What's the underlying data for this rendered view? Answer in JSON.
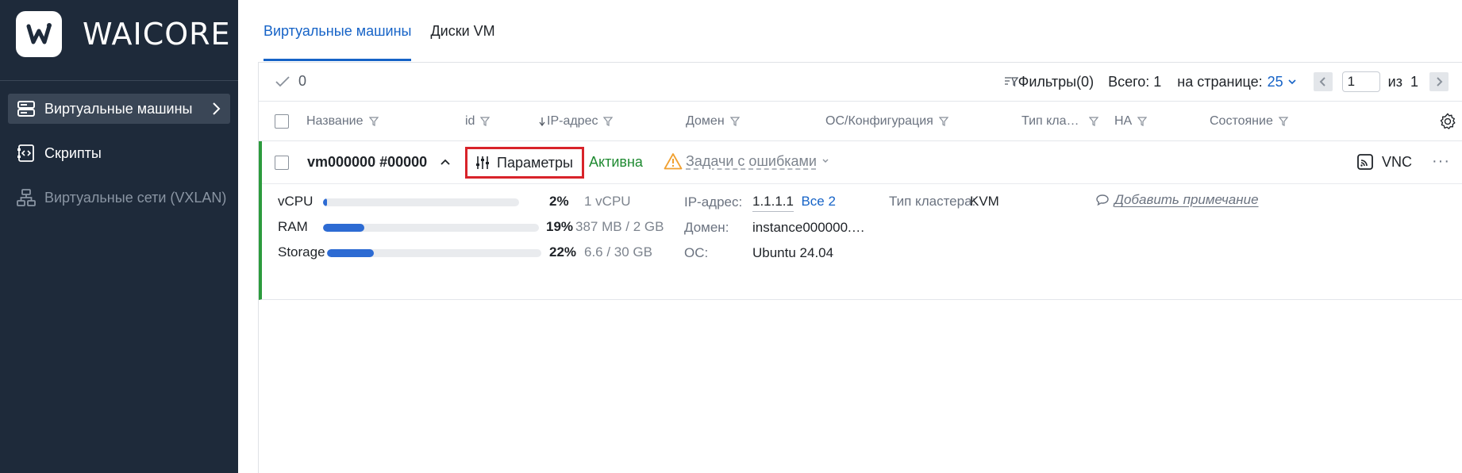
{
  "sidebar": {
    "brand": "WAICORE",
    "items": [
      {
        "label": "Виртуальные машины",
        "icon": "server-icon",
        "active": true
      },
      {
        "label": "Скрипты",
        "icon": "script-icon"
      },
      {
        "label": "Виртуальные сети (VXLAN)",
        "icon": "network-icon",
        "disabled": true
      }
    ]
  },
  "tabs": [
    {
      "label": "Виртуальные машины",
      "active": true
    },
    {
      "label": "Диски VM"
    }
  ],
  "toolbar": {
    "selected_count": "0",
    "filters_label": "Фильтры(0)",
    "total": "Всего: 1",
    "per_page_label": "на странице:",
    "per_page_value": "25",
    "page_value": "1",
    "of_label": "из",
    "total_pages": "1"
  },
  "columns": [
    "Название",
    "id",
    "IP-адрес",
    "Домен",
    "ОС/Конфигурация",
    "Тип кла…",
    "HA",
    "Состояние"
  ],
  "vm": {
    "name": "vm000000 #00000",
    "params_label": "Параметры",
    "status": "Активна",
    "tasks_label": "Задачи с ошибками",
    "vnc_label": "VNC",
    "more": "···",
    "metrics": [
      {
        "label": "vCPU",
        "percent": 2,
        "percent_text": "2%",
        "value": "1 vCPU"
      },
      {
        "label": "RAM",
        "percent": 19,
        "percent_text": "19%",
        "value": "387 MB / 2 GB"
      },
      {
        "label": "Storage",
        "percent": 22,
        "percent_text": "22%",
        "value": "6.6 / 30 GB"
      }
    ],
    "ip_label": "IP-адрес:",
    "ip_value": "1.1.1.1",
    "ip_all_link": "Все 2",
    "domain_label": "Домен:",
    "domain_value": "instance000000.…",
    "os_label": "ОС:",
    "os_value": "Ubuntu 24.04",
    "cluster_label": "Тип кластера:",
    "cluster_value": "KVM",
    "note_link": "Добавить примечание"
  },
  "colors": {
    "sidebar_bg": "#1e2a3a",
    "accent": "#1663c7",
    "active_green": "#1f8a31",
    "highlight_red": "#d8232a",
    "warning_orange": "#f0a030"
  }
}
